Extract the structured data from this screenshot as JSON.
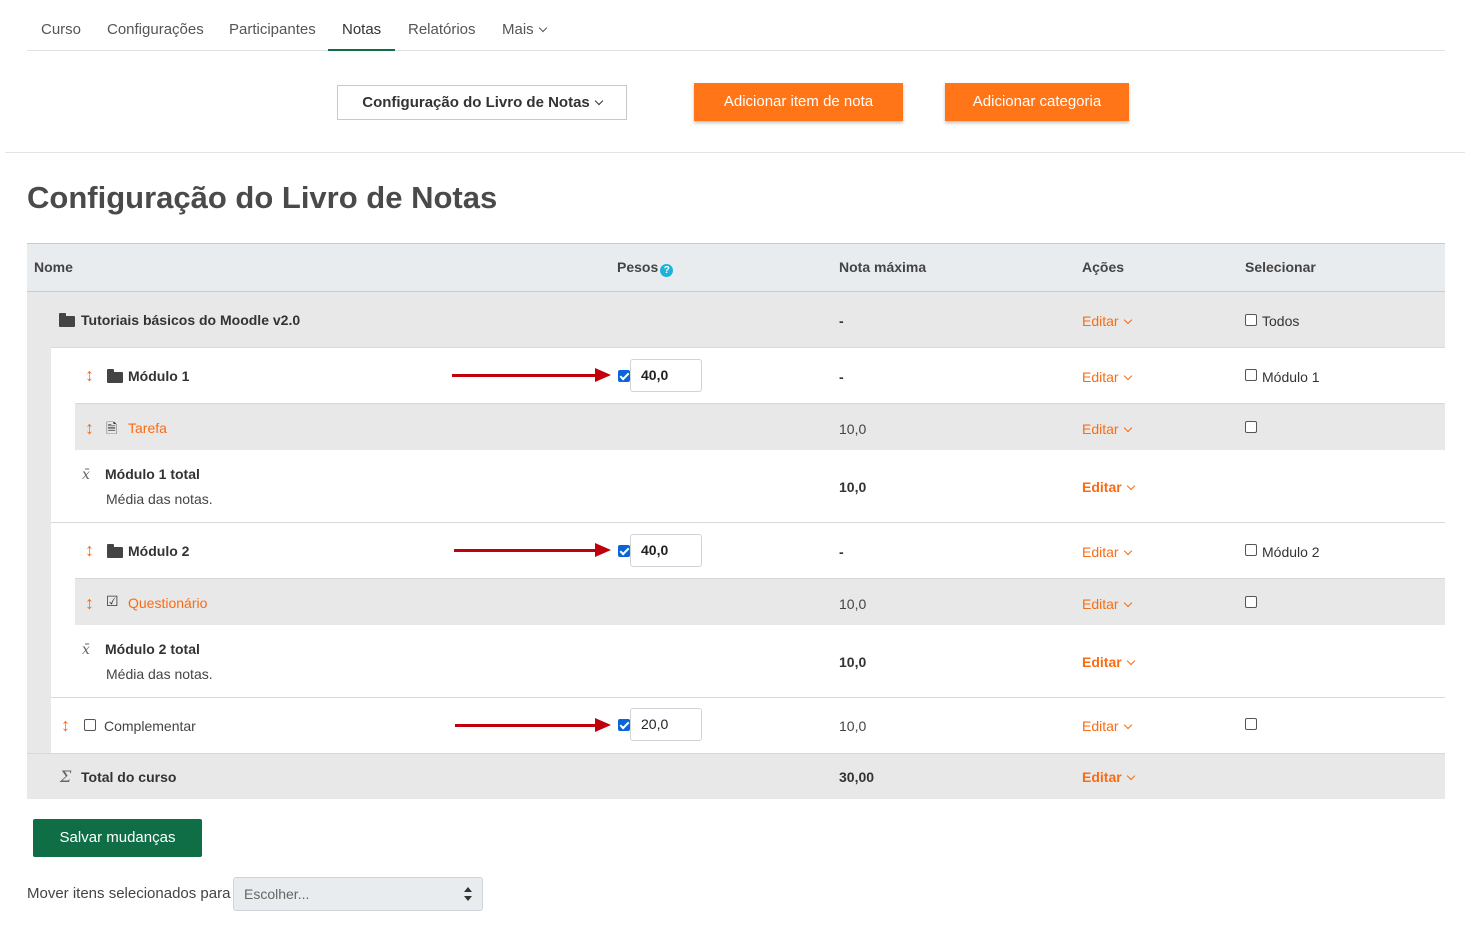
{
  "nav": {
    "tabs": [
      "Curso",
      "Configurações",
      "Participantes",
      "Notas",
      "Relatórios",
      "Mais"
    ],
    "active": "Notas"
  },
  "actions": {
    "selector": "Configuração do Livro de Notas",
    "add_item": "Adicionar item de nota",
    "add_category": "Adicionar categoria"
  },
  "page": {
    "title": "Configuração do Livro de Notas"
  },
  "table": {
    "headers": {
      "name": "Nome",
      "weights": "Pesos",
      "max": "Nota máxima",
      "actions": "Ações",
      "select": "Selecionar"
    },
    "edit_label": "Editar",
    "rows": {
      "course": {
        "name": "Tutoriais básicos do Moodle v2.0",
        "max": "-",
        "select": "Todos"
      },
      "mod1": {
        "name": "Módulo 1",
        "weight": "40,0",
        "max": "-",
        "select": "Módulo 1"
      },
      "tarefa": {
        "name": "Tarefa",
        "max": "10,0"
      },
      "mod1total": {
        "name": "Módulo 1 total",
        "sub": "Média das notas.",
        "max": "10,0"
      },
      "mod2": {
        "name": "Módulo 2",
        "weight": "40,0",
        "max": "-",
        "select": "Módulo 2"
      },
      "quest": {
        "name": "Questionário",
        "max": "10,0"
      },
      "mod2total": {
        "name": "Módulo 2 total",
        "sub": "Média das notas.",
        "max": "10,0"
      },
      "compl": {
        "name": "Complementar",
        "weight": "20,0",
        "max": "10,0"
      },
      "total": {
        "name": "Total do curso",
        "max": "30,00"
      }
    }
  },
  "footer": {
    "save": "Salvar mudanças",
    "move_label": "Mover itens selecionados para",
    "move_placeholder": "Escolher..."
  },
  "colors": {
    "accent": "#f96c14",
    "primary": "#0f6e46",
    "arrow": "#c0000c"
  }
}
